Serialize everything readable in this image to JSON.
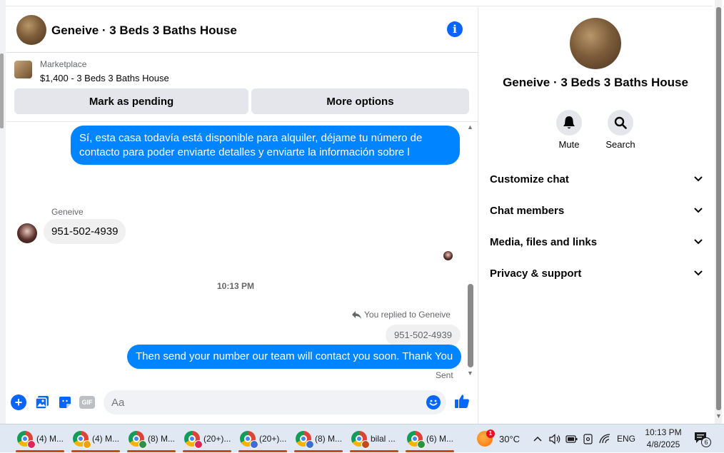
{
  "header": {
    "title": "Geneive · 3 Beds 3 Baths House",
    "info_icon": "i"
  },
  "marketplace": {
    "label": "Marketplace",
    "listing": "$1,400 - 3 Beds 3 Baths House",
    "pending_button": "Mark as pending",
    "more_button": "More options"
  },
  "messages": {
    "outgoing_1": "Sí, esta casa todavía está disponible para alquiler, déjame tu número de contacto para poder enviarte detalles y enviarte la información sobre l",
    "sender_name": "Geneive",
    "incoming_1": "951-502-4939",
    "timestamp": "10:13 PM",
    "reply_note": "You replied to Geneive",
    "reply_quote": "951-502-4939",
    "outgoing_2": "Then send your number our team will contact you soon. Thank You",
    "status": "Sent"
  },
  "composer": {
    "placeholder": "Aa",
    "plus": "+",
    "gif": "GIF"
  },
  "panel": {
    "title": "Geneive · 3 Beds 3 Baths House",
    "mute_label": "Mute",
    "search_label": "Search",
    "sections": [
      "Customize chat",
      "Chat members",
      "Media, files and links",
      "Privacy & support"
    ]
  },
  "taskbar": {
    "items": [
      "(4) M...",
      "(4) M...",
      "(8) M...",
      "(20+)...",
      "(20+)...",
      "(8) M...",
      "bilal ...",
      "(6) M..."
    ],
    "badge_colors": [
      "#e0245e",
      "#f59f00",
      "#2b9348",
      "#e0245e",
      "#3a6fd8",
      "#3a6fd8",
      "#c24b1d",
      "#2b9348"
    ],
    "weather_badge": "1",
    "temperature": "30°C",
    "language": "ENG",
    "time": "10:13 PM",
    "date": "4/8/2025",
    "notification_count": "6"
  },
  "colors": {
    "accent": "#0866ff",
    "bubble": "#0084ff"
  }
}
